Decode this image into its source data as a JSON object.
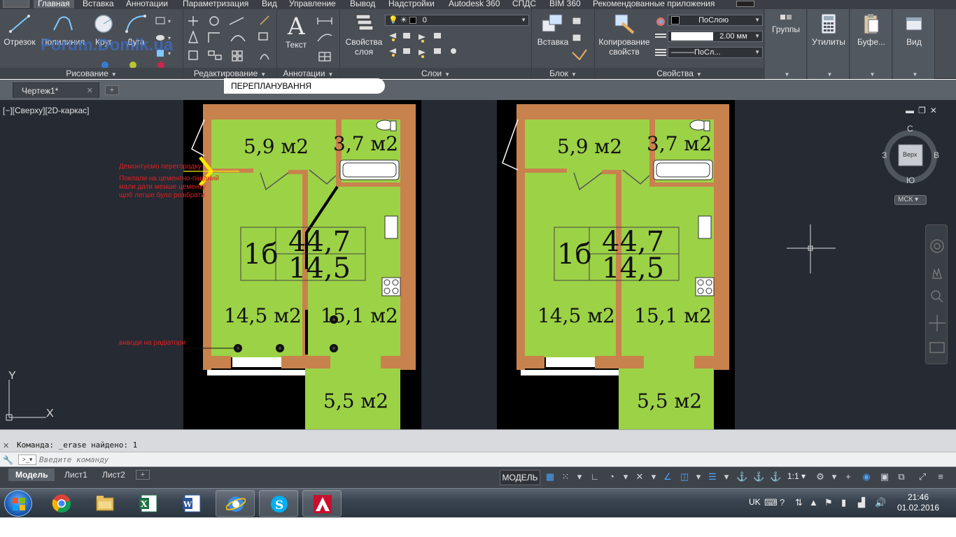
{
  "ribbon_tabs": [
    "Главная",
    "Вставка",
    "Аннотации",
    "Параметризация",
    "Вид",
    "Управление",
    "Вывод",
    "Надстройки",
    "Autodesk 360",
    "СПДС",
    "BIM 360",
    "Рекомендованные приложения"
  ],
  "draw_panel": {
    "title": "Рисование",
    "tools": [
      "Отрезок",
      "Полилиния",
      "Круг",
      "Дуга"
    ]
  },
  "watermark": "Forum.Domik.ua",
  "modify_panel": {
    "title": "Редактирование"
  },
  "annotation_panel": {
    "title": "Аннотации",
    "text_label": "Текст"
  },
  "layers_panel": {
    "title": "Слои",
    "properties_label": "Свойства\nслоя",
    "current_layer": "0"
  },
  "block_panel": {
    "title": "Блок",
    "insert_label": "Вставка"
  },
  "properties_panel": {
    "title": "Свойства",
    "copy_label": "Копирование\nсвойств",
    "color": "ПоСлою",
    "lineweight": "2.00 мм",
    "linetype": "———ПоСл..."
  },
  "extra_panels": [
    "Группы",
    "Утилиты",
    "Буфе...",
    "Вид"
  ],
  "file_tab": "Чертеж1*",
  "redevelopment_label": "ПЕРЕПЛАНУВАННЯ",
  "viewport_label": "[−][Сверху][2D-каркас]",
  "plan": {
    "apartment_number": "1б",
    "total_area": "44,7",
    "living_area": "14,5",
    "rooms": {
      "hall": "5,9 м2",
      "bathroom": "3,7 м2",
      "room": "14,5 м2",
      "kitchen": "15,1 м2",
      "balcony": "5,5 м2"
    }
  },
  "annotations": {
    "demolish_title": "Демонтуємо перегородку",
    "demolish_note": [
      "Поклали на цементно-піщаний",
      "мали дати менше цементу",
      "щоб легше було розібрати"
    ],
    "radiators": "виводи на радіатори"
  },
  "viewcube": {
    "north": "С",
    "south": "Ю",
    "west": "З",
    "east": "В",
    "face": "Верх",
    "ucs": "МСК"
  },
  "ucs_icon": {
    "x": "X",
    "y": "Y"
  },
  "command_history": "Команда: _erase найдено: 1",
  "command_placeholder": "Введите команду",
  "layout_tabs": [
    "Модель",
    "Лист1",
    "Лист2"
  ],
  "status": {
    "model": "МОДЕЛЬ",
    "scale": "1:1"
  },
  "taskbar": {
    "lang": "UK",
    "time": "21:46",
    "date": "01.02.2016"
  },
  "colors": {
    "ribbon": "#4a4f56",
    "canvas": "#252a33",
    "room_fill": "#9cd246",
    "wall": "#c8824e",
    "annotation": "#e02020",
    "arrow": "#ffea00"
  }
}
